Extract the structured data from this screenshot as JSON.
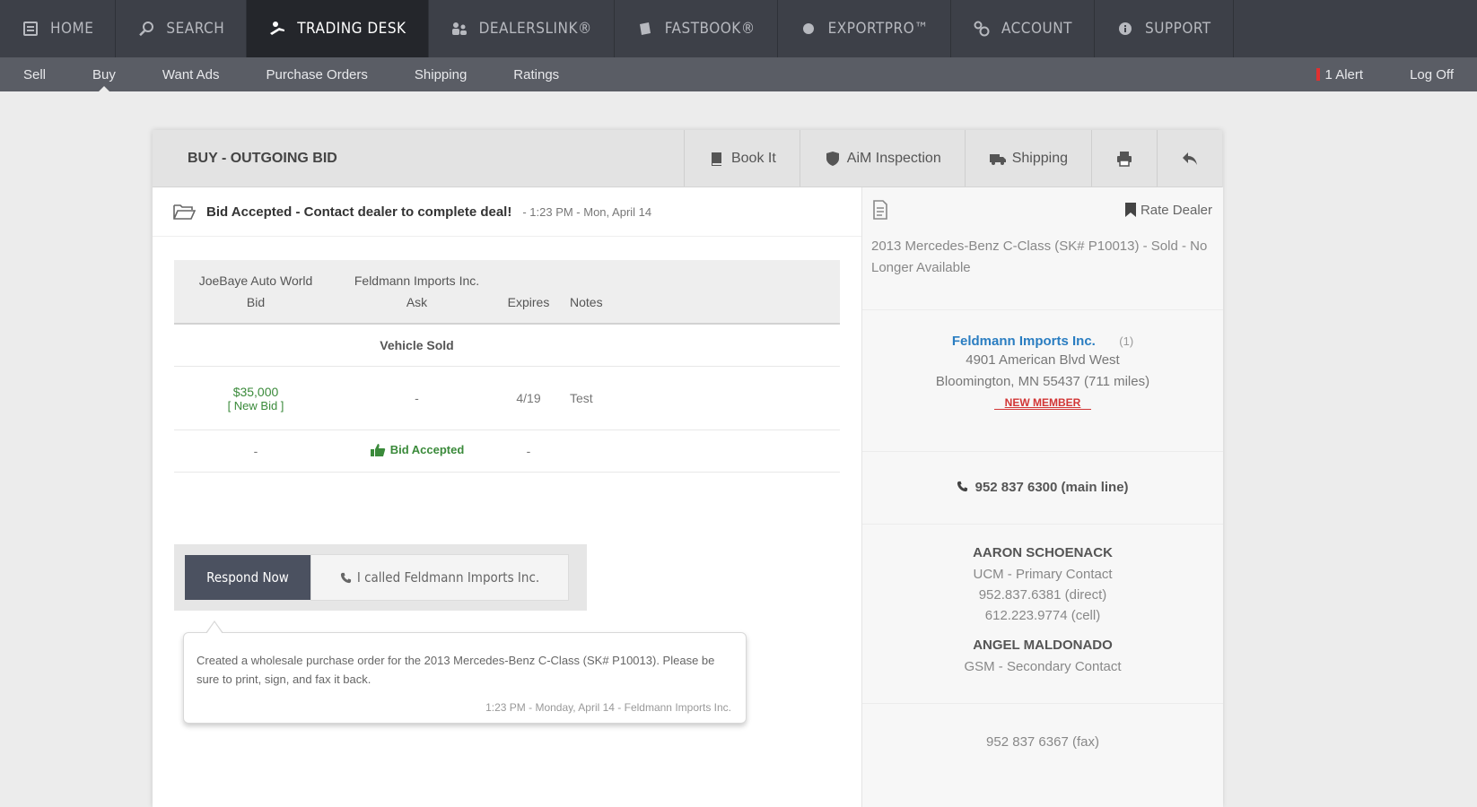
{
  "topnav": {
    "items": [
      {
        "label": "HOME",
        "icon": "home-icon"
      },
      {
        "label": "SEARCH",
        "icon": "search-icon"
      },
      {
        "label": "TRADING DESK",
        "icon": "trading-desk-icon",
        "active": true
      },
      {
        "label": "DEALERSLINK®",
        "icon": "dealers-link-icon"
      },
      {
        "label": "FASTBOOK®",
        "icon": "fastbook-icon"
      },
      {
        "label": "EXPORTPRO™",
        "icon": "globe-icon"
      },
      {
        "label": "ACCOUNT",
        "icon": "gears-icon"
      },
      {
        "label": "SUPPORT",
        "icon": "info-icon"
      }
    ]
  },
  "subnav": {
    "items": [
      "Sell",
      "Buy",
      "Want Ads",
      "Purchase Orders",
      "Shipping",
      "Ratings"
    ],
    "active": "Buy",
    "alert": "1 Alert",
    "logoff": "Log Off"
  },
  "panel": {
    "title": "BUY - OUTGOING BID",
    "tools": {
      "book_it": "Book It",
      "aim_inspection": "AiM Inspection",
      "shipping": "Shipping"
    },
    "status": {
      "message": "Bid Accepted - Contact dealer to complete deal!",
      "timestamp": "- 1:23 PM - Mon, April 14"
    },
    "table": {
      "headers": {
        "bid_dealer": "JoeBaye Auto World",
        "bid": "Bid",
        "ask_dealer": "Feldmann Imports Inc.",
        "ask": "Ask",
        "expires": "Expires",
        "notes": "Notes"
      },
      "vehicle_sold": "Vehicle Sold",
      "bid_row": {
        "amount": "$35,000",
        "new_bid": "[ New Bid ]",
        "ask": "-",
        "expires": "4/19",
        "notes": "Test"
      },
      "accepted_row": {
        "bid": "-",
        "status": "Bid Accepted",
        "expires": "-"
      }
    },
    "buttons": {
      "respond": "Respond Now",
      "called": "I called Feldmann Imports Inc."
    },
    "note": {
      "text": "Created a wholesale purchase order for the 2013 Mercedes-Benz C-Class (SK# P10013). Please be sure to print, sign, and fax it back.",
      "meta": "1:23 PM - Monday, April 14 - Feldmann Imports Inc."
    }
  },
  "sidebar": {
    "rate_dealer": "Rate Dealer",
    "vehicle": "2013 Mercedes-Benz C-Class (SK# P10013) - Sold - No Longer Available",
    "dealer": {
      "name": "Feldmann Imports Inc.",
      "rating": "(1)",
      "address1": "4901 American Blvd West",
      "address2": "Bloomington, MN 55437 (711 miles)",
      "badge": "NEW MEMBER"
    },
    "phone": "952 837 6300 (main line)",
    "contacts": [
      {
        "name": "AARON SCHOENACK",
        "lines": [
          "UCM - Primary Contact",
          "952.837.6381 (direct)",
          "612.223.9774 (cell)"
        ]
      },
      {
        "name": "ANGEL MALDONADO",
        "lines": [
          "GSM - Secondary Contact"
        ]
      }
    ],
    "fax": "952 837 6367 (fax)"
  },
  "colors": {
    "topnav_bg": "#3d4048",
    "subnav_bg": "#5a5d65",
    "accent_green": "#3a8a3a",
    "dealer_link": "#2a7dc1",
    "alert_red": "#e03030"
  }
}
